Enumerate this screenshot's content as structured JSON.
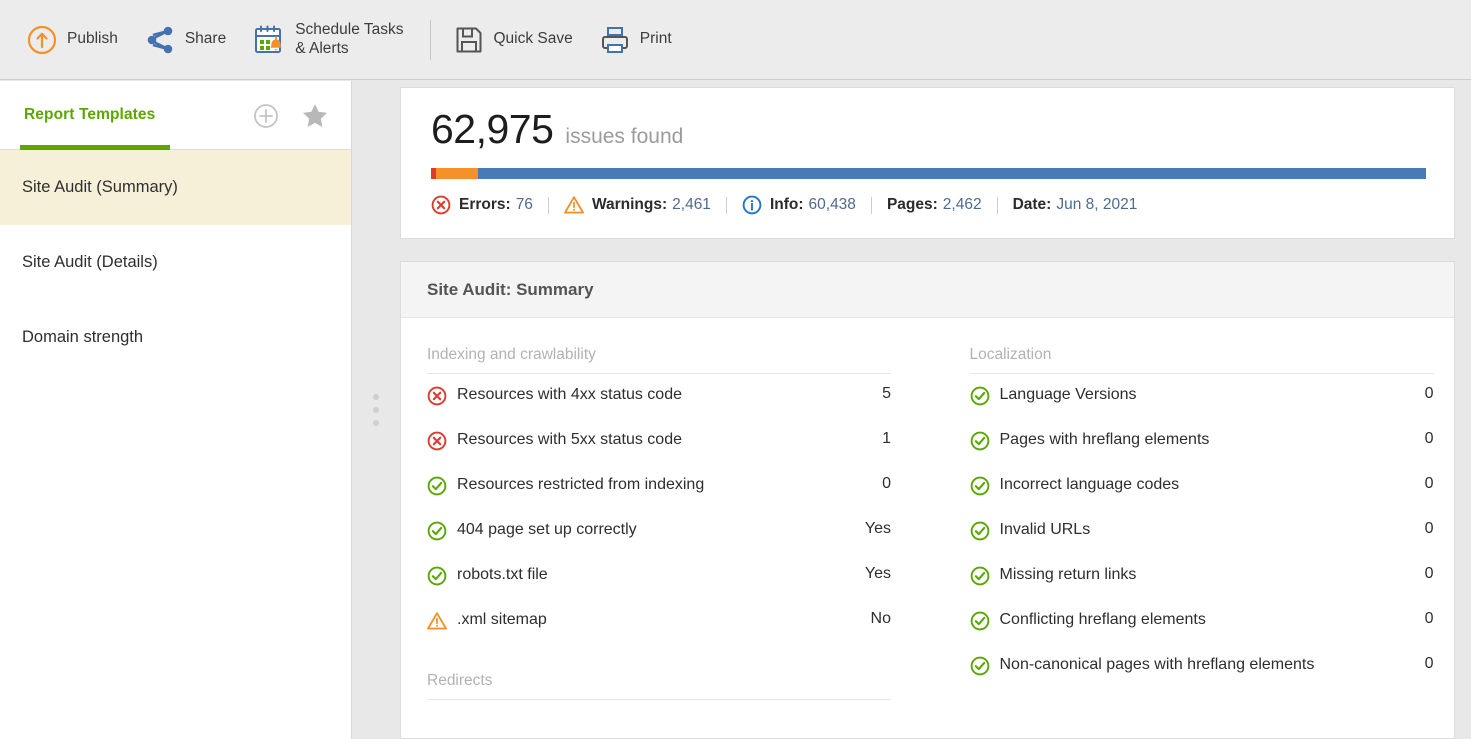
{
  "toolbar": {
    "buttons": [
      {
        "icon": "publish-icon",
        "label": "Publish"
      },
      {
        "icon": "share-icon",
        "label": "Share"
      },
      {
        "icon": "schedule-icon",
        "label": "Schedule Tasks\n& Alerts"
      },
      {
        "icon": "save-icon",
        "label": "Quick Save"
      },
      {
        "icon": "print-icon",
        "label": "Print"
      }
    ]
  },
  "sidebar": {
    "title": "Report Templates",
    "add_icon": "plus-circle-icon",
    "favorite_icon": "star-icon",
    "items": [
      {
        "label": "Site Audit (Summary)",
        "active": true
      },
      {
        "label": "Site Audit (Details)",
        "active": false
      },
      {
        "label": "Domain strength",
        "active": false
      }
    ]
  },
  "hero": {
    "count": "62,975",
    "subtitle": "issues found",
    "progress": [
      {
        "color": "#e03a2f",
        "pct": 0.5
      },
      {
        "color": "#f59128",
        "pct": 4.2
      },
      {
        "color": "#4a7ab5",
        "pct": 95.3
      }
    ],
    "stats": [
      {
        "icon": "error-icon",
        "label": "Errors:",
        "value": "76"
      },
      {
        "icon": "warning-icon",
        "label": "Warnings:",
        "value": "2,461"
      },
      {
        "icon": "info-icon",
        "label": "Info:",
        "value": "60,438"
      },
      {
        "icon": null,
        "label": "Pages:",
        "value": "2,462"
      },
      {
        "icon": null,
        "label": "Date:",
        "value": "Jun 8, 2021"
      }
    ]
  },
  "detail": {
    "title": "Site Audit: Summary",
    "left_column": [
      {
        "kind": "group",
        "title": "Indexing and crawlability"
      },
      {
        "kind": "row",
        "icon": "error-icon",
        "label": "Resources with 4xx status code",
        "value": "5"
      },
      {
        "kind": "row",
        "icon": "error-icon",
        "label": "Resources with 5xx status code",
        "value": "1"
      },
      {
        "kind": "row",
        "icon": "success-icon",
        "label": "Resources restricted from indexing",
        "value": "0"
      },
      {
        "kind": "row",
        "icon": "success-icon",
        "label": "404 page set up correctly",
        "value": "Yes"
      },
      {
        "kind": "row",
        "icon": "success-icon",
        "label": "robots.txt file",
        "value": "Yes"
      },
      {
        "kind": "row",
        "icon": "warning-icon",
        "label": ".xml sitemap",
        "value": "No"
      },
      {
        "kind": "group",
        "title": "Redirects"
      }
    ],
    "right_column": [
      {
        "kind": "group",
        "title": "Localization"
      },
      {
        "kind": "row",
        "icon": "success-icon",
        "label": "Language Versions",
        "value": "0"
      },
      {
        "kind": "row",
        "icon": "success-icon",
        "label": "Pages with hreflang elements",
        "value": "0"
      },
      {
        "kind": "row",
        "icon": "success-icon",
        "label": "Incorrect language codes",
        "value": "0"
      },
      {
        "kind": "row",
        "icon": "success-icon",
        "label": "Invalid URLs",
        "value": "0"
      },
      {
        "kind": "row",
        "icon": "success-icon",
        "label": "Missing return links",
        "value": "0"
      },
      {
        "kind": "row",
        "icon": "success-icon",
        "label": "Conflicting hreflang elements",
        "value": "0"
      },
      {
        "kind": "row",
        "icon": "success-icon",
        "label": "Non-canonical pages with hreflang elements",
        "value": "0"
      }
    ]
  },
  "colors": {
    "brand_green": "#5aa700",
    "error_red": "#e03a2f",
    "warning_orange": "#f59128",
    "info_blue": "#2176c7",
    "success_green": "#5aa700",
    "progress_blue": "#4a7ab5",
    "active_row": "#f7f0d9"
  }
}
